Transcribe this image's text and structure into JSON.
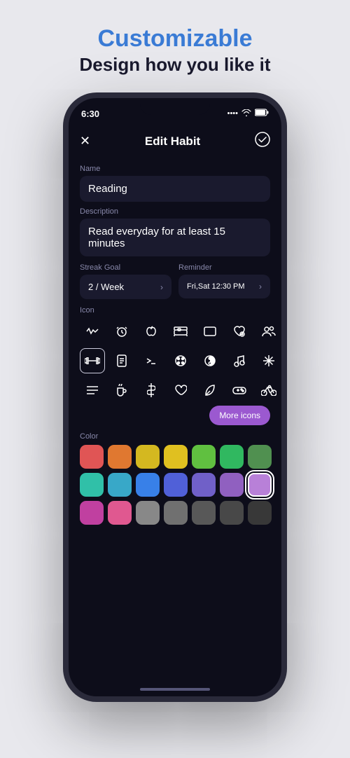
{
  "header": {
    "title": "Customizable",
    "subtitle": "Design how you like it"
  },
  "phone": {
    "status": {
      "time": "6:30",
      "wifi": "WiFi",
      "battery": "Battery"
    },
    "screen": {
      "topbar": {
        "close_icon": "✕",
        "title": "Edit Habit",
        "check_icon": "✓"
      },
      "name_label": "Name",
      "name_value": "Reading",
      "description_label": "Description",
      "description_value": "Read everyday for at least 15 minutes",
      "streak_goal_label": "Streak Goal",
      "streak_goal_value": "2 / Week",
      "reminder_label": "Reminder",
      "reminder_value": "Fri,Sat 12:30 PM",
      "icon_label": "Icon",
      "icons": [
        "〜",
        "⏰",
        "🍎",
        "🛏",
        "⬜",
        "❤",
        "🕸",
        "🏋",
        "📋",
        "➤",
        "🎨",
        "☯",
        "🎵",
        "✨",
        "≡",
        "☕",
        "$",
        "♡",
        "🍃",
        "🎮",
        "🚴"
      ],
      "selected_icon_index": 7,
      "more_icons_label": "More icons",
      "color_label": "Color",
      "colors": [
        {
          "hex": "#e05555",
          "selected": false
        },
        {
          "hex": "#e07830",
          "selected": false
        },
        {
          "hex": "#d4b820",
          "selected": false
        },
        {
          "hex": "#e0c020",
          "selected": false
        },
        {
          "hex": "#60c040",
          "selected": false
        },
        {
          "hex": "#30b860",
          "selected": false
        },
        {
          "hex": "#509050",
          "selected": false
        },
        {
          "hex": "#30c0a8",
          "selected": false
        },
        {
          "hex": "#38a8c8",
          "selected": false
        },
        {
          "hex": "#3880e8",
          "selected": false
        },
        {
          "hex": "#5060d8",
          "selected": false
        },
        {
          "hex": "#7060c8",
          "selected": false
        },
        {
          "hex": "#9060c0",
          "selected": false
        },
        {
          "hex": "#b880d8",
          "selected": true
        },
        {
          "hex": "#c040a0",
          "selected": false
        },
        {
          "hex": "#e05890",
          "selected": false
        },
        {
          "hex": "#888888",
          "selected": false
        },
        {
          "hex": "#707070",
          "selected": false
        },
        {
          "hex": "#585858",
          "selected": false
        },
        {
          "hex": "#484848",
          "selected": false
        },
        {
          "hex": "#383838",
          "selected": false
        }
      ]
    }
  }
}
